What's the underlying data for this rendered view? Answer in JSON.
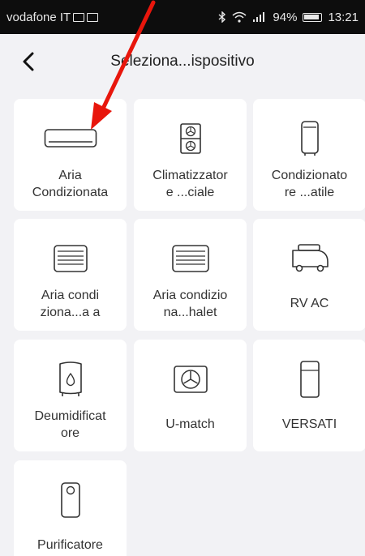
{
  "status_bar": {
    "carrier": "vodafone IT",
    "battery": "94%",
    "time": "13:21"
  },
  "header": {
    "title": "Seleziona...ispositivo"
  },
  "icons": {
    "back": "chevron-left-icon",
    "bluetooth": "bluetooth-icon",
    "wifi": "wifi-icon",
    "signal": "signal-icon"
  },
  "annotation_color": "#e8160c",
  "devices": [
    {
      "label": "Aria\nCondizionata",
      "icon": "split-ac-icon"
    },
    {
      "label": "Climatizzator\ne ...ciale",
      "icon": "commercial-ac-icon"
    },
    {
      "label": "Condizionato\nre ...atile",
      "icon": "portable-ac-icon"
    },
    {
      "label": "Aria condi\nziona...a a",
      "icon": "window-ac-icon"
    },
    {
      "label": "Aria condizio\nna...halet",
      "icon": "chalet-ac-icon"
    },
    {
      "label": "RV AC",
      "icon": "rv-icon"
    },
    {
      "label": "Deumidificat\nore",
      "icon": "dehumidifier-icon"
    },
    {
      "label": "U-match",
      "icon": "fan-unit-icon"
    },
    {
      "label": "VERSATI",
      "icon": "versati-icon"
    },
    {
      "label": "Purificatore",
      "icon": "purifier-icon"
    }
  ]
}
